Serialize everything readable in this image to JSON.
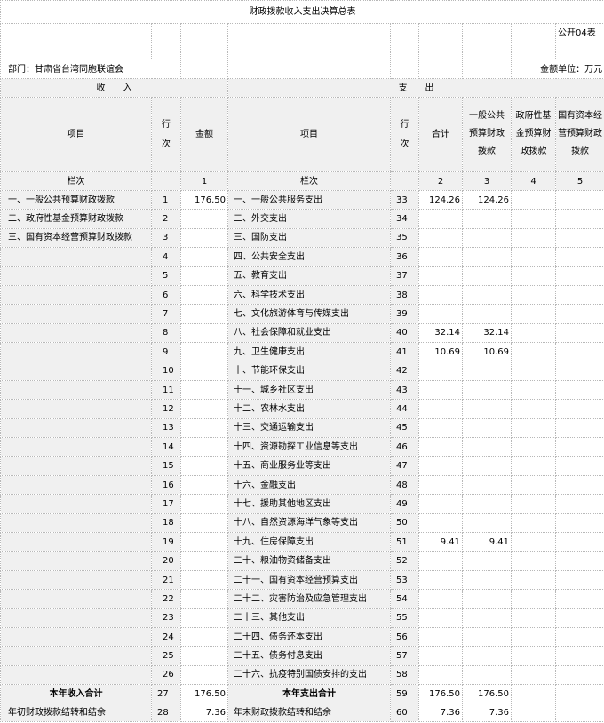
{
  "title": "财政拨款收入支出决算总表",
  "form_code": "公开04表",
  "department_label": "部门：甘肃省台湾同胞联谊会",
  "unit_label": "金额单位：万元",
  "section_income": "收　　入",
  "section_expense": "支　　出",
  "headers": {
    "item": "项目",
    "row_no": "行次",
    "amount": "金额",
    "expense_item": "项目",
    "expense_row_no": "行次",
    "total": "合计",
    "general_budget": "一般公共预算财政拨款",
    "gov_fund": "政府性基金预算财政拨款",
    "state_capital": "国有资本经营预算财政拨款"
  },
  "column_index_row": {
    "label_left": "栏次",
    "c1": "1",
    "label_right": "栏次",
    "c2": "2",
    "c3": "3",
    "c4": "4",
    "c5": "5"
  },
  "rows": [
    {
      "in_item": "一、一般公共预算财政拨款",
      "in_no": "1",
      "in_amt": "176.50",
      "ex_item": "一、一般公共服务支出",
      "ex_no": "33",
      "total": "124.26",
      "gen": "124.26",
      "fund": "",
      "cap": ""
    },
    {
      "in_item": "二、政府性基金预算财政拨款",
      "in_no": "2",
      "in_amt": "",
      "ex_item": "二、外交支出",
      "ex_no": "34",
      "total": "",
      "gen": "",
      "fund": "",
      "cap": ""
    },
    {
      "in_item": "三、国有资本经营预算财政拨款",
      "in_no": "3",
      "in_amt": "",
      "ex_item": "三、国防支出",
      "ex_no": "35",
      "total": "",
      "gen": "",
      "fund": "",
      "cap": ""
    },
    {
      "in_item": "",
      "in_no": "4",
      "in_amt": "",
      "ex_item": "四、公共安全支出",
      "ex_no": "36",
      "total": "",
      "gen": "",
      "fund": "",
      "cap": ""
    },
    {
      "in_item": "",
      "in_no": "5",
      "in_amt": "",
      "ex_item": "五、教育支出",
      "ex_no": "37",
      "total": "",
      "gen": "",
      "fund": "",
      "cap": ""
    },
    {
      "in_item": "",
      "in_no": "6",
      "in_amt": "",
      "ex_item": "六、科学技术支出",
      "ex_no": "38",
      "total": "",
      "gen": "",
      "fund": "",
      "cap": ""
    },
    {
      "in_item": "",
      "in_no": "7",
      "in_amt": "",
      "ex_item": "七、文化旅游体育与传媒支出",
      "ex_no": "39",
      "total": "",
      "gen": "",
      "fund": "",
      "cap": ""
    },
    {
      "in_item": "",
      "in_no": "8",
      "in_amt": "",
      "ex_item": "八、社会保障和就业支出",
      "ex_no": "40",
      "total": "32.14",
      "gen": "32.14",
      "fund": "",
      "cap": ""
    },
    {
      "in_item": "",
      "in_no": "9",
      "in_amt": "",
      "ex_item": "九、卫生健康支出",
      "ex_no": "41",
      "total": "10.69",
      "gen": "10.69",
      "fund": "",
      "cap": ""
    },
    {
      "in_item": "",
      "in_no": "10",
      "in_amt": "",
      "ex_item": "十、节能环保支出",
      "ex_no": "42",
      "total": "",
      "gen": "",
      "fund": "",
      "cap": ""
    },
    {
      "in_item": "",
      "in_no": "11",
      "in_amt": "",
      "ex_item": "十一、城乡社区支出",
      "ex_no": "43",
      "total": "",
      "gen": "",
      "fund": "",
      "cap": ""
    },
    {
      "in_item": "",
      "in_no": "12",
      "in_amt": "",
      "ex_item": "十二、农林水支出",
      "ex_no": "44",
      "total": "",
      "gen": "",
      "fund": "",
      "cap": ""
    },
    {
      "in_item": "",
      "in_no": "13",
      "in_amt": "",
      "ex_item": "十三、交通运输支出",
      "ex_no": "45",
      "total": "",
      "gen": "",
      "fund": "",
      "cap": ""
    },
    {
      "in_item": "",
      "in_no": "14",
      "in_amt": "",
      "ex_item": "十四、资源勘探工业信息等支出",
      "ex_no": "46",
      "total": "",
      "gen": "",
      "fund": "",
      "cap": ""
    },
    {
      "in_item": "",
      "in_no": "15",
      "in_amt": "",
      "ex_item": "十五、商业服务业等支出",
      "ex_no": "47",
      "total": "",
      "gen": "",
      "fund": "",
      "cap": ""
    },
    {
      "in_item": "",
      "in_no": "16",
      "in_amt": "",
      "ex_item": "十六、金融支出",
      "ex_no": "48",
      "total": "",
      "gen": "",
      "fund": "",
      "cap": ""
    },
    {
      "in_item": "",
      "in_no": "17",
      "in_amt": "",
      "ex_item": "十七、援助其他地区支出",
      "ex_no": "49",
      "total": "",
      "gen": "",
      "fund": "",
      "cap": ""
    },
    {
      "in_item": "",
      "in_no": "18",
      "in_amt": "",
      "ex_item": "十八、自然资源海洋气象等支出",
      "ex_no": "50",
      "total": "",
      "gen": "",
      "fund": "",
      "cap": ""
    },
    {
      "in_item": "",
      "in_no": "19",
      "in_amt": "",
      "ex_item": "十九、住房保障支出",
      "ex_no": "51",
      "total": "9.41",
      "gen": "9.41",
      "fund": "",
      "cap": ""
    },
    {
      "in_item": "",
      "in_no": "20",
      "in_amt": "",
      "ex_item": "二十、粮油物资储备支出",
      "ex_no": "52",
      "total": "",
      "gen": "",
      "fund": "",
      "cap": ""
    },
    {
      "in_item": "",
      "in_no": "21",
      "in_amt": "",
      "ex_item": "二十一、国有资本经营预算支出",
      "ex_no": "53",
      "total": "",
      "gen": "",
      "fund": "",
      "cap": ""
    },
    {
      "in_item": "",
      "in_no": "22",
      "in_amt": "",
      "ex_item": "二十二、灾害防治及应急管理支出",
      "ex_no": "54",
      "total": "",
      "gen": "",
      "fund": "",
      "cap": ""
    },
    {
      "in_item": "",
      "in_no": "23",
      "in_amt": "",
      "ex_item": "二十三、其他支出",
      "ex_no": "55",
      "total": "",
      "gen": "",
      "fund": "",
      "cap": ""
    },
    {
      "in_item": "",
      "in_no": "24",
      "in_amt": "",
      "ex_item": "二十四、债务还本支出",
      "ex_no": "56",
      "total": "",
      "gen": "",
      "fund": "",
      "cap": ""
    },
    {
      "in_item": "",
      "in_no": "25",
      "in_amt": "",
      "ex_item": "二十五、债务付息支出",
      "ex_no": "57",
      "total": "",
      "gen": "",
      "fund": "",
      "cap": ""
    },
    {
      "in_item": "",
      "in_no": "26",
      "in_amt": "",
      "ex_item": "二十六、抗疫特别国债安排的支出",
      "ex_no": "58",
      "total": "",
      "gen": "",
      "fund": "",
      "cap": ""
    }
  ],
  "total_row": {
    "in_item": "本年收入合计",
    "in_no": "27",
    "in_amt": "176.50",
    "ex_item": "本年支出合计",
    "ex_no": "59",
    "total": "176.50",
    "gen": "176.50",
    "fund": "",
    "cap": ""
  },
  "carry_row": {
    "in_item": "年初财政拨款结转和结余",
    "in_no": "28",
    "in_amt": "7.36",
    "ex_item": "年末财政拨款结转和结余",
    "ex_no": "60",
    "total": "7.36",
    "gen": "7.36",
    "fund": "",
    "cap": ""
  }
}
